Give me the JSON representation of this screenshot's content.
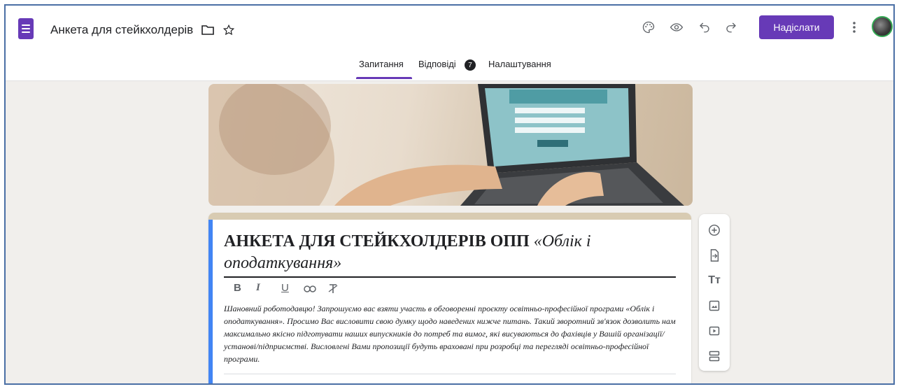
{
  "app": {
    "title": "Анкета для стейкхолдерів"
  },
  "header": {
    "send_label": "Надіслати"
  },
  "tabs": [
    {
      "label": "Запитання",
      "active": true
    },
    {
      "label": "Відповіді",
      "badge": "7"
    },
    {
      "label": "Налаштування"
    }
  ],
  "form": {
    "title": "АНКЕТА ДЛЯ СТЕЙКХОЛДЕРІВ ОПП ",
    "title_italic": "«Облік і оподаткування»",
    "description": "Шановний роботодавцю! Запрошуємо вас взяти участь в обговоренні проєкту освітньо-професійної програми «Облік і оподаткування». Просимо Вас висловити свою думку щодо наведених нижче питань. Такий зворотний зв'язок дозволить нам максимально якісно підготувати наших випускників до потреб та вимог, які висуваються до фахівців у Вашій організації/установі/підприємстві. Висловлені Вами пропозиції будуть враховані при розробці та перегляді освітньо-професійної програми."
  },
  "formatting_toolbar": [
    "B",
    "I",
    "U"
  ],
  "icons": {
    "app": "google-forms-icon",
    "folder": "folder-icon",
    "star": "star-icon",
    "palette": "palette-icon",
    "preview": "eye-icon",
    "undo": "undo-icon",
    "redo": "redo-icon",
    "more": "more-vert-icon",
    "side": [
      "add-question-icon",
      "import-questions-icon",
      "add-title-icon",
      "add-image-icon",
      "add-video-icon",
      "add-section-icon"
    ]
  },
  "colors": {
    "accent": "#673ab7",
    "card_left": "#4285f4",
    "header_bar": "#d8cbb2"
  }
}
